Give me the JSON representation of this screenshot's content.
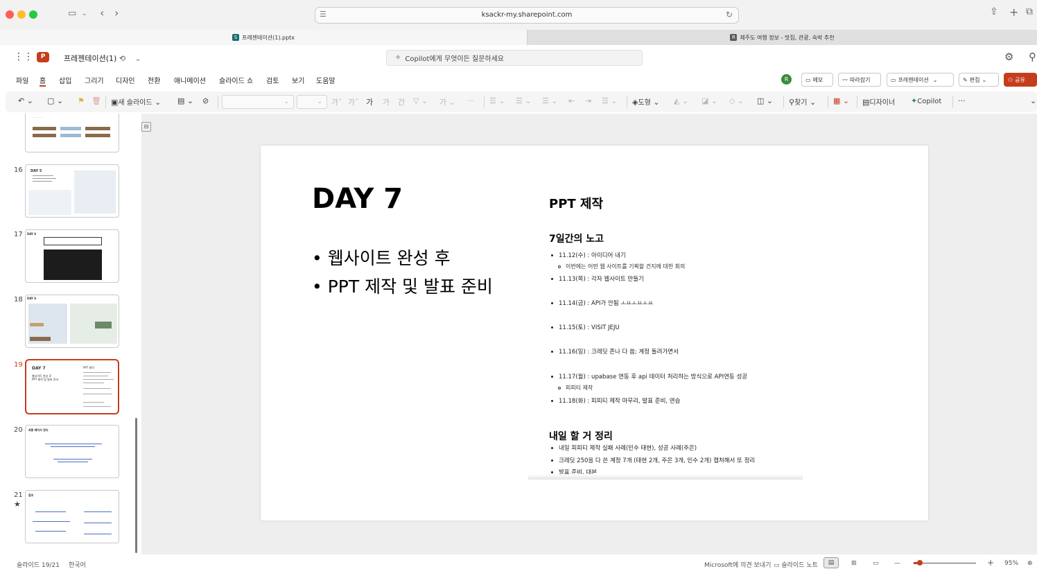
{
  "browser": {
    "url": "ksackr-my.sharepoint.com",
    "tabs": [
      {
        "title": "프레젠테이션(1).pptx",
        "favicon": "S",
        "favicon_color": "#1b6e6e",
        "active": true
      },
      {
        "title": "제주도 여행 정보 - 맛집, 관광, 숙박 추천",
        "favicon": "R",
        "favicon_color": "#5a5a5a",
        "active": false
      }
    ]
  },
  "app": {
    "file_name": "프레젠테이션(1)",
    "logo_letter": "P",
    "copilot_placeholder": "Copilot에게 무엇이든 질문하세요",
    "accent_color": "#c43e1c"
  },
  "menu": {
    "items": [
      "파일",
      "홈",
      "삽입",
      "그리기",
      "디자인",
      "전환",
      "애니메이션",
      "슬라이드 쇼",
      "검토",
      "보기",
      "도움말"
    ],
    "avatar_letter": "R",
    "memo": "메모",
    "follow": "따라잡기",
    "present": "프레젠테이션",
    "edit": "편집",
    "share": "공유"
  },
  "ribbon": {
    "new_slide": "새 슬라이드",
    "shape": "도형",
    "find": "찾기",
    "designer": "디자이너",
    "copilot": "Copilot",
    "more": "···"
  },
  "thumbnails": [
    {
      "number": "16",
      "title": "DAY 5"
    },
    {
      "number": "17",
      "title": "DAY 6"
    },
    {
      "number": "18",
      "title": "DAY 6"
    },
    {
      "number": "19",
      "title": "DAY 7",
      "selected": true
    },
    {
      "number": "20",
      "title": "최종 페이지 정리"
    },
    {
      "number": "21",
      "title": "참조",
      "star": "★"
    }
  ],
  "slide": {
    "title": "DAY 7",
    "bullets": [
      "웹사이트 완성 후",
      "PPT 제작 및 발표 준비"
    ],
    "right_title": "PPT 제작",
    "section1": {
      "heading": "7일간의 노고",
      "items": [
        {
          "text": "11.12(수) : 아이디어 내기",
          "sub": [
            "이번에는 어떤 웹 사이트를 기획할 건지에 대한 회의"
          ]
        },
        {
          "text": "11.13(목) : 각자 웹사이트 만들기",
          "sub": []
        },
        {
          "text": "11.14(금) : API가 안됨 ㅗㅛㅗㅛㅗㅛ",
          "sub": []
        },
        {
          "text": "11.15(토) : VISIT JEJU",
          "sub": []
        },
        {
          "text": "11.16(일) : 크레딧 존나 다 씀; 계정 돌려가면서",
          "sub": []
        },
        {
          "text": "11.17(월) : upabase 연동 후 api 데이터 처리하는 방식으로 API연동 성공",
          "sub": [
            "피피티 제작"
          ]
        },
        {
          "text": "11.18(화) : 피피티 제작 마무리, 발표 준비, 연습",
          "sub": []
        }
      ]
    },
    "section2": {
      "heading": "내일 할 거 정리",
      "items": [
        "내일 피피티 제작 실패 사례(민수 태현), 성공 사례(주은)",
        "크레딧 250을 다 쓴 계정 7개 (태현 2개, 주은 3개, 민수 2개) 캡처해서 또 정리",
        "발표 준비, 대본"
      ]
    }
  },
  "status": {
    "slide_info": "슬라이드 19/21",
    "language": "한국어",
    "feedback": "Microsoft에 의견 보내기",
    "notes": "슬라이드 노트",
    "zoom": "95%",
    "zoom_fraction": 0.1
  }
}
